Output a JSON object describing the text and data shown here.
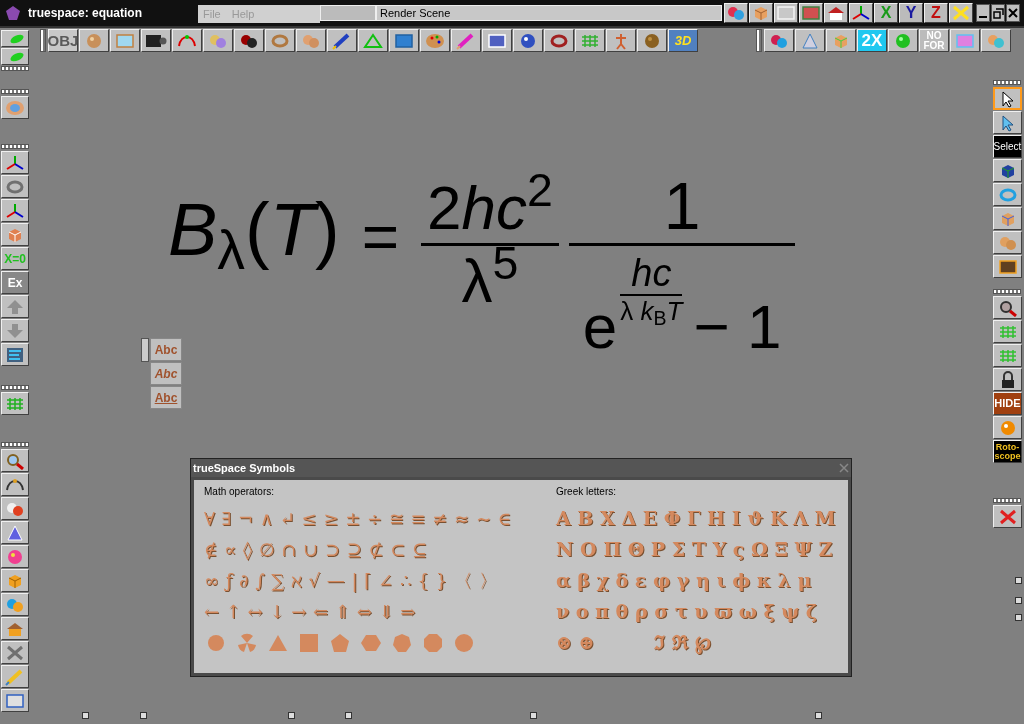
{
  "window": {
    "title": "truespace: equation"
  },
  "menu": [
    {
      "label": "File",
      "disabled": true
    },
    {
      "label": "Help",
      "disabled": true
    }
  ],
  "render_field": {
    "value": "Render Scene"
  },
  "title_toolbar": [
    {
      "kind": "icon"
    },
    {
      "kind": "icon"
    },
    {
      "kind": "icon"
    },
    {
      "kind": "icon"
    },
    {
      "kind": "icon"
    },
    {
      "kind": "icon"
    },
    {
      "kind": "text",
      "label": "X"
    },
    {
      "kind": "text",
      "label": "Y"
    },
    {
      "kind": "text",
      "label": "Z"
    },
    {
      "kind": "icon"
    }
  ],
  "top_toolbar": [
    {
      "kind": "text",
      "label": "OBJ"
    },
    {
      "kind": "icon"
    },
    {
      "kind": "icon"
    },
    {
      "kind": "icon"
    },
    {
      "kind": "icon"
    },
    {
      "kind": "icon"
    },
    {
      "kind": "icon"
    },
    {
      "kind": "icon"
    },
    {
      "kind": "icon"
    },
    {
      "kind": "icon"
    },
    {
      "kind": "icon"
    },
    {
      "kind": "icon"
    },
    {
      "kind": "icon"
    },
    {
      "kind": "icon"
    },
    {
      "kind": "icon"
    },
    {
      "kind": "icon"
    },
    {
      "kind": "icon"
    },
    {
      "kind": "icon"
    },
    {
      "kind": "icon"
    },
    {
      "kind": "icon"
    },
    {
      "kind": "text",
      "label": "3D"
    }
  ],
  "top_right_toolbar": [
    {
      "kind": "icon"
    },
    {
      "kind": "icon"
    },
    {
      "kind": "icon"
    },
    {
      "kind": "text",
      "label": "2X"
    },
    {
      "kind": "icon"
    },
    {
      "kind": "text",
      "label": "NO FOR"
    },
    {
      "kind": "icon"
    },
    {
      "kind": "icon"
    }
  ],
  "left_toolbars": [
    {
      "buttons": [
        {
          "kind": "icon"
        },
        {
          "kind": "icon"
        }
      ]
    },
    {
      "buttons": [
        {
          "kind": "icon"
        }
      ]
    },
    {
      "buttons": [
        {
          "kind": "icon"
        },
        {
          "kind": "icon"
        },
        {
          "kind": "icon"
        },
        {
          "kind": "icon"
        },
        {
          "kind": "text",
          "label": "X=0"
        },
        {
          "kind": "text",
          "label": "Ex"
        },
        {
          "kind": "icon"
        },
        {
          "kind": "icon"
        },
        {
          "kind": "icon"
        }
      ]
    },
    {
      "buttons": [
        {
          "kind": "icon"
        }
      ]
    },
    {
      "buttons": [
        {
          "kind": "icon"
        },
        {
          "kind": "icon"
        },
        {
          "kind": "icon"
        },
        {
          "kind": "icon"
        },
        {
          "kind": "icon"
        },
        {
          "kind": "icon"
        },
        {
          "kind": "icon"
        },
        {
          "kind": "icon"
        },
        {
          "kind": "icon"
        },
        {
          "kind": "icon"
        },
        {
          "kind": "icon"
        }
      ]
    }
  ],
  "right_toolbars": [
    {
      "buttons": [
        {
          "kind": "icon",
          "selected": true
        },
        {
          "kind": "icon",
          "selected": false
        },
        {
          "kind": "text",
          "label": "Select",
          "selected": false
        },
        {
          "kind": "icon",
          "selected": false
        },
        {
          "kind": "icon",
          "selected": false
        },
        {
          "kind": "icon",
          "selected": false
        },
        {
          "kind": "icon",
          "selected": false
        },
        {
          "kind": "icon",
          "selected": false
        }
      ]
    },
    {
      "buttons": [
        {
          "kind": "icon"
        },
        {
          "kind": "icon"
        },
        {
          "kind": "icon"
        },
        {
          "kind": "icon"
        },
        {
          "kind": "text",
          "label": "HIDE"
        },
        {
          "kind": "icon"
        },
        {
          "kind": "text",
          "label": "Roto-scope"
        }
      ]
    },
    {
      "buttons": [
        {
          "kind": "icon"
        }
      ]
    }
  ],
  "text_toolbar": [
    {
      "label": "Abc"
    },
    {
      "label": "Abc"
    },
    {
      "label": "Abc"
    }
  ],
  "equation": {
    "lhs": "*B*$_{λ}$(*T*)",
    "equals": "=",
    "fraction_1": {
      "coefficient": "2",
      "numerator": "*hc*$^{2}$",
      "denominator": "λ$^{5}$"
    },
    "fraction_2": {
      "numerator": "1",
      "base": "e",
      "exponent_numerator": "*hc*",
      "exponent_denominator": "λ *k*$_{B}$*T*",
      "tail": "− 1"
    }
  },
  "symbols_panel": {
    "title": "trueSpace Symbols",
    "groups": [
      {
        "label": "Math operators:",
        "rows": [
          {
            "kind": "text",
            "parts": [
              "∀ ∃ ¬ ∧ ↵ ≤ ≥ ± ÷ ≅ ≡ ≠ ≈ ~ ∈"
            ]
          },
          {
            "kind": "text",
            "parts": [
              "∉ ∝ ◊ ∅ ∩ ∪ ⊃ ⊇ ⊄ ⊂ ⊆"
            ]
          },
          {
            "kind": "text",
            "parts": [
              "∞ ƒ ∂ ∫ ∑ ℵ √ — | ⌈ ∠ ∴ { } 〈 〉"
            ]
          },
          {
            "kind": "text",
            "parts": [
              "← ↑ ↔ ↓ → ⇐ ⇑ ⇔ ⇓ ⇒"
            ]
          },
          {
            "kind": "shapes"
          }
        ]
      },
      {
        "label": "Greek letters:",
        "rows": [
          {
            "kind": "text",
            "parts": [
              "Α Β Χ Δ Ε Φ Γ Η Ι ϑ Κ Λ Μ"
            ]
          },
          {
            "kind": "text",
            "parts": [
              "Ν Ο Π Θ Ρ Σ Τ Υ ς Ω Ξ Ψ Ζ"
            ]
          },
          {
            "kind": "text",
            "parts": [
              "α β χ δ ε φ γ η ι ϕ κ λ μ"
            ]
          },
          {
            "kind": "text",
            "parts": [
              "ν ο π θ ρ σ τ υ ϖ ω ξ ψ ζ"
            ]
          },
          {
            "kind": "text",
            "parts": [
              "⊗ ⊕",
              "ℑ ℜ ℘"
            ]
          }
        ]
      }
    ]
  }
}
